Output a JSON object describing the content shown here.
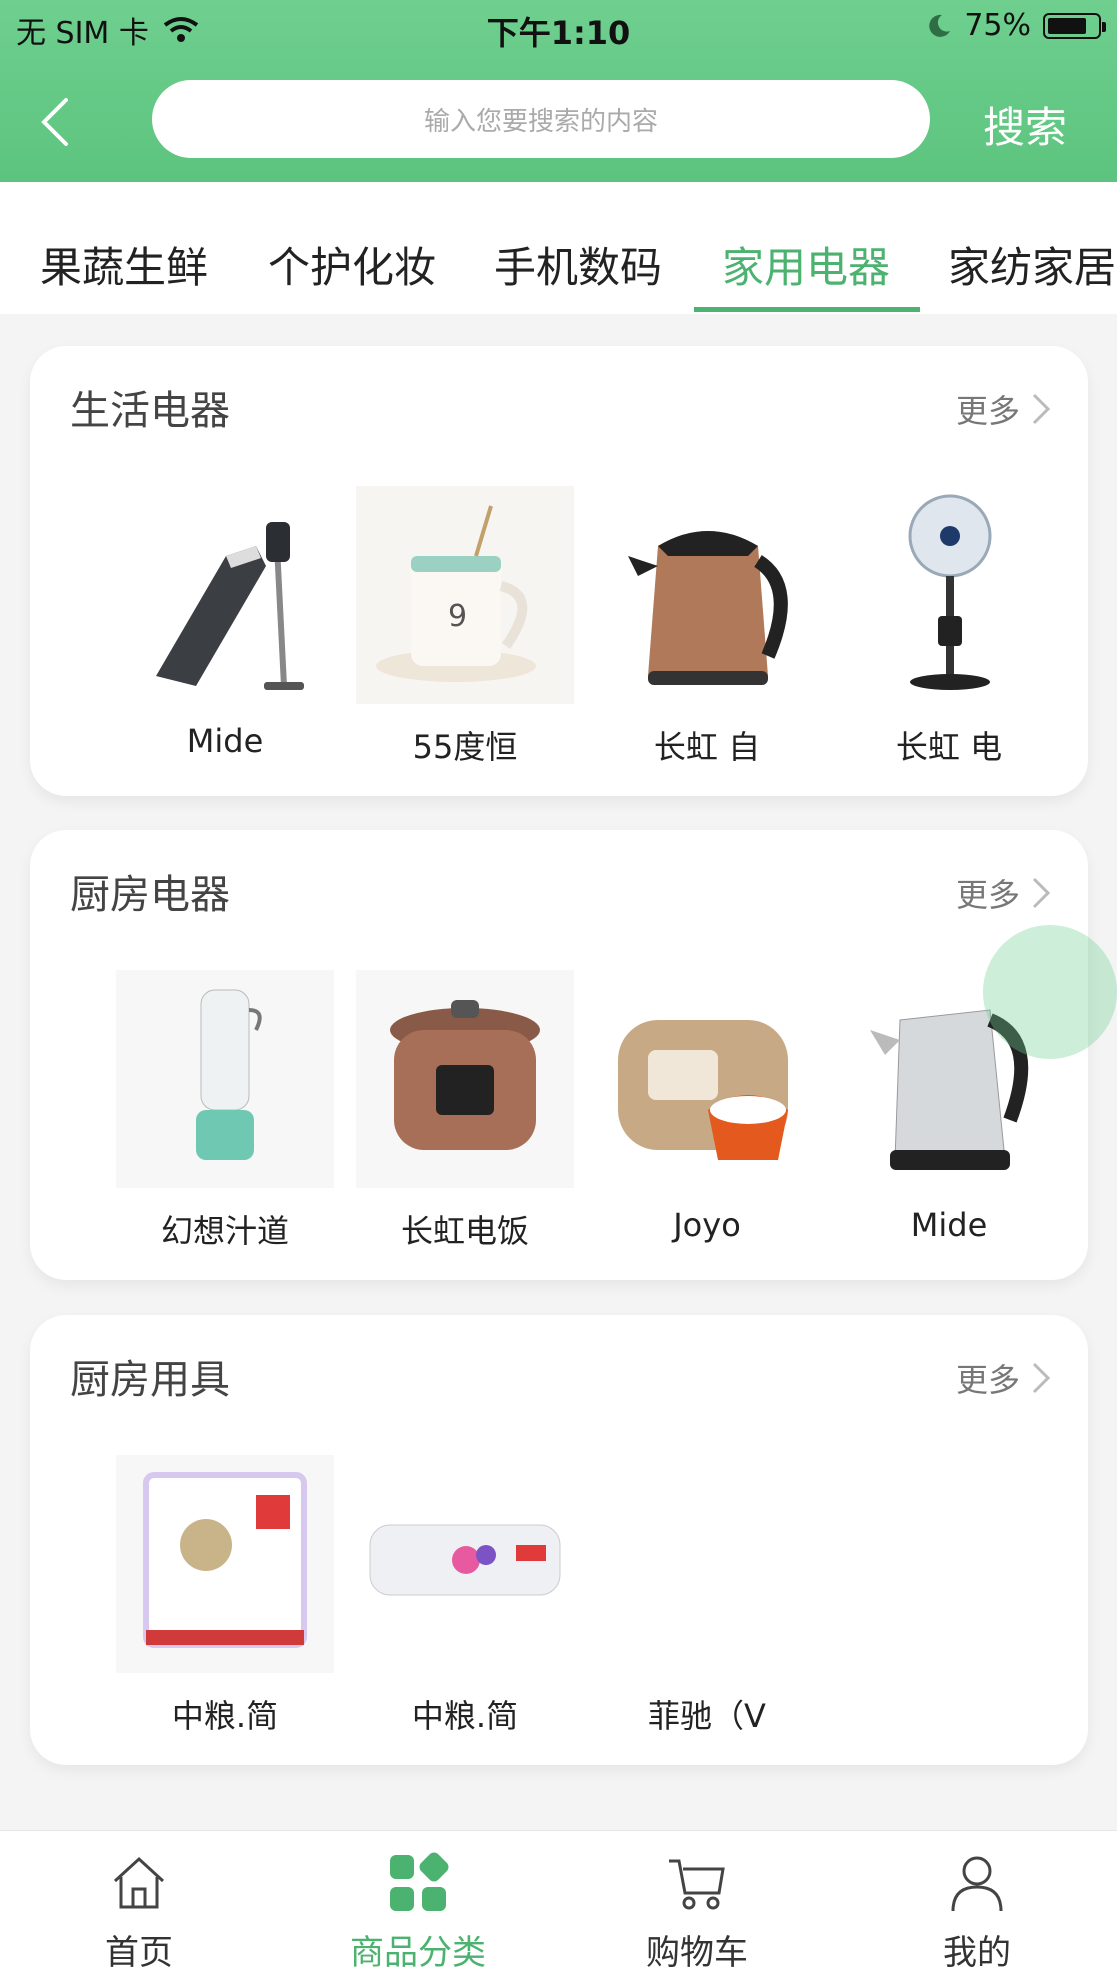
{
  "status_bar": {
    "carrier": "无 SIM 卡",
    "time": "下午1:10",
    "battery": "75%"
  },
  "search": {
    "placeholder": "输入您要搜索的内容",
    "button_label": "搜索"
  },
  "categories": {
    "items": [
      "果蔬生鲜",
      "个护化妆",
      "手机数码",
      "家用电器",
      "家纺家居"
    ],
    "active": "家用电器"
  },
  "sections": [
    {
      "title": "生活电器",
      "more_label": "更多",
      "items": [
        {
          "label": "Mide",
          "icon": "vacuum-icon"
        },
        {
          "label": "55度恒",
          "icon": "warmer-mug-icon"
        },
        {
          "label": "长虹 自",
          "icon": "kettle-icon"
        },
        {
          "label": "长虹 电",
          "icon": "fan-icon"
        }
      ]
    },
    {
      "title": "厨房电器",
      "more_label": "更多",
      "items": [
        {
          "label": "幻想汁道",
          "icon": "juicer-icon"
        },
        {
          "label": "长虹电饭",
          "icon": "pressure-cooker-icon"
        },
        {
          "label": "Joyo",
          "icon": "rice-cooker-icon"
        },
        {
          "label": "Mide",
          "icon": "steel-kettle-icon"
        }
      ]
    },
    {
      "title": "厨房用具",
      "more_label": "更多",
      "items": [
        {
          "label": "中粮.简",
          "icon": "garbage-bags-icon"
        },
        {
          "label": "中粮.简",
          "icon": "cling-film-icon"
        },
        {
          "label": "菲驰（V",
          "icon": "blank-icon"
        }
      ]
    }
  ],
  "tabbar": {
    "items": [
      {
        "label": "首页",
        "icon": "home-icon"
      },
      {
        "label": "商品分类",
        "icon": "category-icon"
      },
      {
        "label": "购物车",
        "icon": "cart-icon"
      },
      {
        "label": "我的",
        "icon": "user-icon"
      }
    ],
    "active": "商品分类"
  },
  "colors": {
    "accent": "#4cb26f",
    "header": "#5cc47e"
  }
}
